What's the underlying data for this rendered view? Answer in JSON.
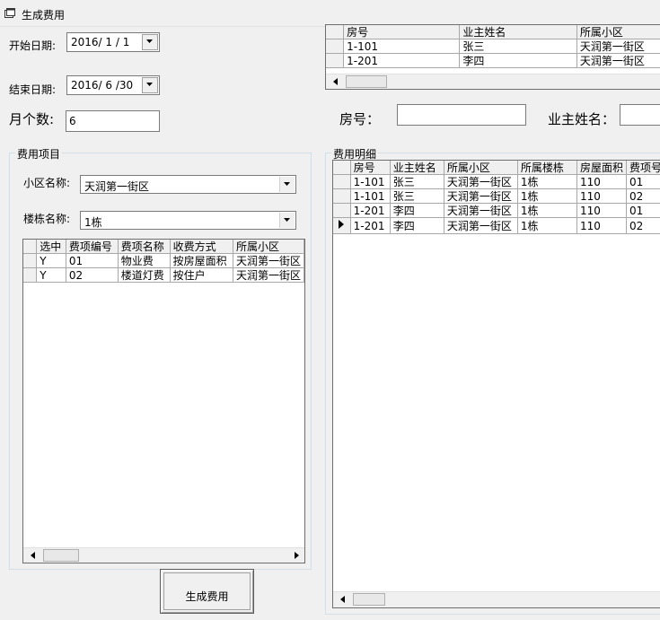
{
  "window": {
    "title": "生成费用"
  },
  "form": {
    "start_date_label": "开始日期:",
    "start_date_value": "2016/ 1 / 1",
    "end_date_label": "结束日期:",
    "end_date_value": "2016/ 6 /30",
    "months_label": "月个数:",
    "months_value": "6",
    "room_label": "房号：",
    "room_value": "",
    "owner_label": "业主姓名：",
    "owner_value": "",
    "generate_button": "生成费用"
  },
  "fee_items_group": {
    "title": "费用项目",
    "community_label": "小区名称:",
    "community_value": "天润第一街区",
    "building_label": "楼栋名称:",
    "building_value": "1栋",
    "grid": {
      "columns": [
        "选中",
        "费项编号",
        "费项名称",
        "收费方式",
        "所属小区"
      ],
      "rows": [
        [
          "Y",
          "01",
          "物业费",
          "按房屋面积",
          "天润第一街区"
        ],
        [
          "Y",
          "02",
          "楼道灯费",
          "按住户",
          "天润第一街区"
        ]
      ]
    }
  },
  "owners_grid": {
    "columns": [
      "房号",
      "业主姓名",
      "所属小区"
    ],
    "rows": [
      [
        "1-101",
        "张三",
        "天润第一街区"
      ],
      [
        "1-201",
        "李四",
        "天润第一街区"
      ]
    ]
  },
  "fee_detail_group": {
    "title": "费用明细",
    "grid": {
      "columns": [
        "房号",
        "业主姓名",
        "所属小区",
        "所属楼栋",
        "房屋面积",
        "费项号"
      ],
      "rows": [
        [
          "1-101",
          "张三",
          "天润第一街区",
          "1栋",
          "110",
          "01"
        ],
        [
          "1-101",
          "张三",
          "天润第一街区",
          "1栋",
          "110",
          "02"
        ],
        [
          "1-201",
          "李四",
          "天润第一街区",
          "1栋",
          "110",
          "01"
        ],
        [
          "1-201",
          "李四",
          "天润第一街区",
          "1栋",
          "110",
          "02"
        ]
      ],
      "current_row_index": 3
    }
  }
}
